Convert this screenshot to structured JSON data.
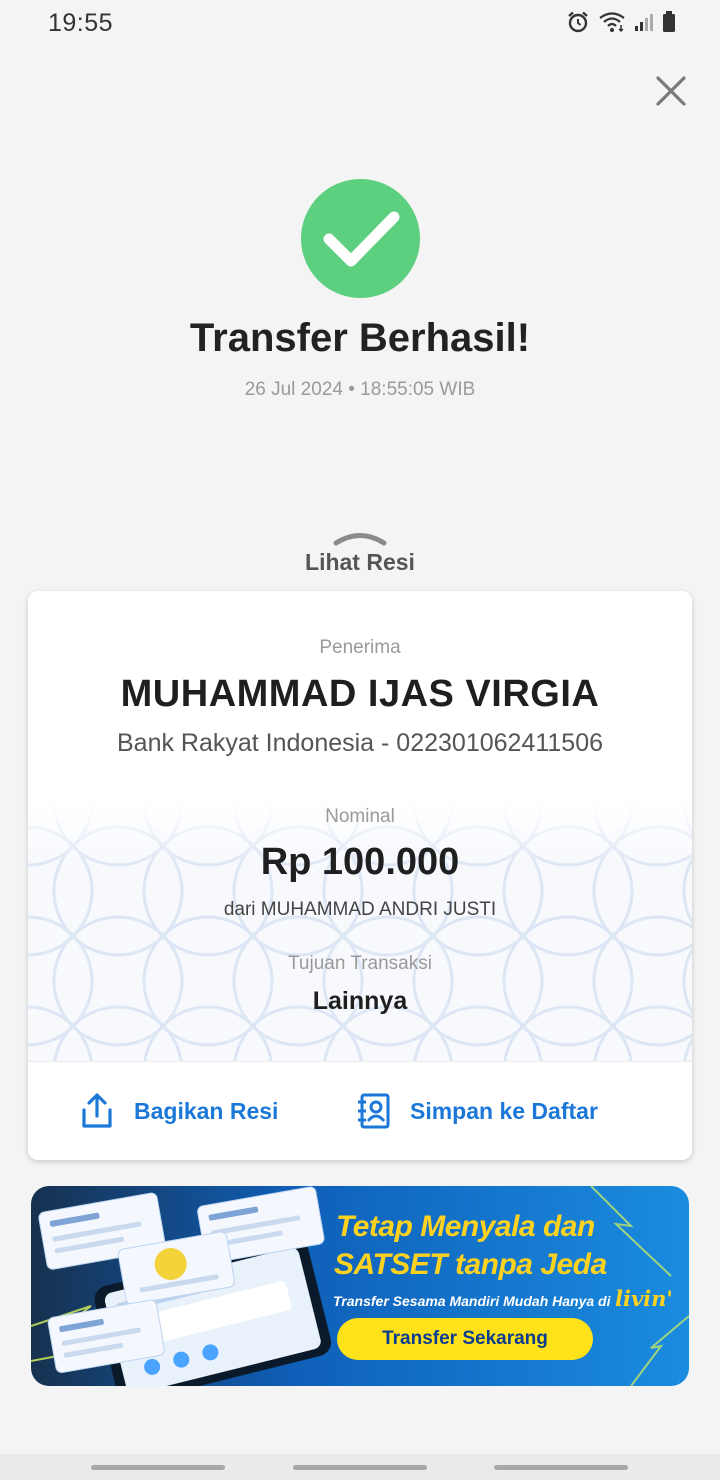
{
  "status_bar": {
    "time": "19:55",
    "icons": [
      "alarm-icon",
      "wifi-icon",
      "signal-icon",
      "battery-icon"
    ]
  },
  "header": {
    "close_icon": "close-icon"
  },
  "result": {
    "title": "Transfer Berhasil!",
    "datetime": "26 Jul 2024 • 18:55:05 WIB",
    "status_color": "#5cd07e"
  },
  "receipt_toggle": {
    "label": "Lihat Resi"
  },
  "receipt": {
    "recipient_label": "Penerima",
    "recipient_name": "MUHAMMAD IJAS VIRGIA",
    "recipient_bank": "Bank Rakyat Indonesia - 022301062411506",
    "amount_label": "Nominal",
    "amount": "Rp 100.000",
    "sender": "dari MUHAMMAD ANDRI JUSTI",
    "purpose_label": "Tujuan Transaksi",
    "purpose": "Lainnya"
  },
  "actions": {
    "share_label": "Bagikan Resi",
    "save_label": "Simpan ke Daftar",
    "accent_color": "#1b78d8"
  },
  "banner": {
    "headline_line1": "Tetap Menyala dan",
    "headline_line2": "SATSET tanpa Jeda",
    "subtitle": "Transfer Sesama Mandiri Mudah Hanya di",
    "logo": "livin'",
    "button_label": "Transfer Sekarang"
  }
}
